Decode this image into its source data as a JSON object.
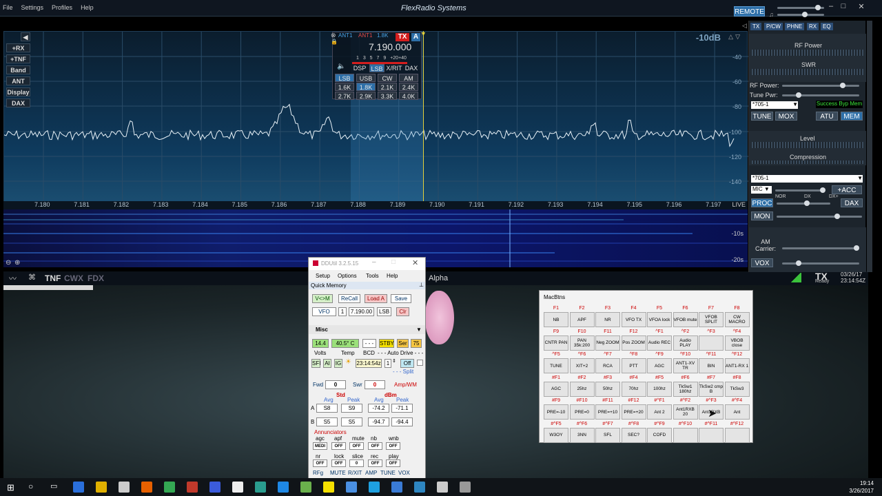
{
  "window": {
    "brand": "FlexRadio Systems",
    "remote": "REMOTE",
    "menu": [
      "File",
      "Settings",
      "Profiles",
      "Help"
    ]
  },
  "pan": {
    "db": "-10dB",
    "ylabels": [
      "-40",
      "-60",
      "-80",
      "-100",
      "-120",
      "-140"
    ],
    "wf_labels": [
      "-10s",
      "-20s"
    ],
    "live": "LIVE",
    "freqs": [
      "7.180",
      "7.181",
      "7.182",
      "7.183",
      "7.184",
      "7.185",
      "7.186",
      "7.187",
      "7.188",
      "7.189",
      "7.190",
      "7.191",
      "7.192",
      "7.193",
      "7.194",
      "7.195",
      "7.196",
      "7.197"
    ]
  },
  "left_buttons": [
    "+RX",
    "+TNF",
    "Band",
    "ANT",
    "Display",
    "DAX"
  ],
  "slice": {
    "ant1": "ANT1",
    "ant2": "ANT1",
    "bw": "1.8K",
    "tx": "TX",
    "letter": "A",
    "freq": "7.190.000",
    "scale": "1 3 5 7 9 +20+40",
    "row1": [
      "DSP",
      "LSB",
      "X/RIT",
      "DAX"
    ],
    "modes": [
      "LSB",
      "USB",
      "CW",
      "AM"
    ],
    "filters1": [
      "1.6K",
      "1.8K",
      "2.1K",
      "2.4K"
    ],
    "filters2": [
      "2.7K",
      "2.9K",
      "3.3K",
      "4.0K"
    ]
  },
  "status": {
    "tnf": "TNF",
    "cwx": "CWX",
    "fdx": "FDX",
    "alpha": "Alpha",
    "tx": "TX",
    "ready": "Ready",
    "date": "03/26/17",
    "time": "23:14:54Z"
  },
  "rpanel": {
    "tabs": [
      "TX",
      "P/CW",
      "PHNE",
      "RX",
      "EQ"
    ],
    "rfpower": "RF Power",
    "swr": "SWR",
    "rf_power_lbl": "RF Power:",
    "tune_pwr": "Tune Pwr:",
    "profile": "*705-1",
    "success": "Success Byp Mem",
    "tune": "TUNE",
    "mox": "MOX",
    "atu": "ATU",
    "mem": "MEM",
    "level": "Level",
    "compression": "Compression",
    "profile2": "*705-1",
    "mic": "MIC",
    "acc": "+ACC",
    "nor": "NOR",
    "dx": "DX",
    "dxplus": "DX+",
    "proc": "PROC",
    "dax": "DAX",
    "mon": "MON",
    "am_carrier": "AM Carrier:",
    "vox": "VOX"
  },
  "ddutil": {
    "title": "DDUtil 3.2.5.15",
    "menu": [
      "Setup",
      "Options",
      "Tools",
      "Help"
    ],
    "qm": "Quick Memory",
    "vm": "V<>M",
    "recall": "ReCall",
    "loada": "Load A",
    "save": "Save",
    "vfo": "VFO",
    "vfo_num": "1",
    "freq": "7.190.00",
    "mode": "LSB",
    "clr": "Clr",
    "misc": "Misc",
    "volts": "14.4",
    "temp": "40.5° C",
    "bcd": "- - -",
    "stby": "STBY",
    "ser": "Ser",
    "num75": "75",
    "lbl_volts": "Volts",
    "lbl_temp": "Temp",
    "lbl_bcd": "BCD",
    "auto": "- - - Auto Drive - - -",
    "sfi": "SFI",
    "ai": "AI",
    "ig": "IG",
    "time": "23:14:54z",
    "spin": "1",
    "off": "Off",
    "split": "- - - Split",
    "fwd": "Fwd",
    "fwd_v": "0",
    "swr": "Swr",
    "swr_v": "0",
    "ampwm": "Amp/WM",
    "std": "Std",
    "dbm": "dBm",
    "avg": "Avg",
    "peak": "Peak",
    "avg2": "Avg",
    "peak2": "Peak",
    "a": "A",
    "a_vals": [
      "S8",
      "S9",
      "-74.2",
      "-71.1"
    ],
    "b": "B",
    "b_vals": [
      "S5",
      "S5",
      "-94.7",
      "-94.4"
    ],
    "annun": "Annunciators",
    "ann1_lbl": [
      "agc",
      "apf",
      "mute",
      "nb",
      "wnb"
    ],
    "ann1_val": [
      "MEDI",
      "OFF",
      "OFF",
      "OFF",
      "OFF"
    ],
    "ann2_lbl": [
      "nr",
      "lock",
      "slice",
      "rec",
      "play"
    ],
    "ann2_val": [
      "OFF",
      "OFF",
      "0",
      "OFF",
      "OFF"
    ],
    "ann3_lbl": [
      "RFg",
      "MUTE",
      "R/XIT",
      "AMP",
      "TUNE",
      "VOX"
    ]
  },
  "macbtns": {
    "title": "MacBtns",
    "rows": [
      {
        "keys": [
          "F1",
          "F2",
          "F3",
          "F4",
          "F5",
          "F6",
          "F7",
          "F8"
        ],
        "btns": [
          "NB",
          "APF",
          "NR",
          "VFO TX",
          "VFOA lock",
          "VFOB mute",
          "VFOB SPLIT",
          "CW MACRO"
        ]
      },
      {
        "keys": [
          "F9",
          "F10",
          "F11",
          "F12",
          "^F1",
          "^F2",
          "^F3",
          "^F4"
        ],
        "btns": [
          "CNTR PAN",
          "PAN 35k:200",
          "Neg ZOOM",
          "Pos ZOOM",
          "Audio REC",
          "Audio PLAY",
          "",
          "VBOB close"
        ]
      },
      {
        "keys": [
          "^F5",
          "^F6",
          "^F7",
          "^F8",
          "^F9",
          "^F10",
          "^F11",
          "^F12"
        ],
        "btns": [
          "TUNE",
          "XIT+2",
          "RCA",
          "PTT",
          "AGC",
          "ANT1-XV TR",
          "BIN",
          "ANT1-RX 1"
        ]
      },
      {
        "keys": [
          "#F1",
          "#F2",
          "#F3",
          "#F4",
          "#F5",
          "#F6",
          "#F7",
          "#F8"
        ],
        "btns": [
          "AGC",
          "25hz",
          "50hz",
          "70hz",
          "100hz",
          "TkSw1 180hz",
          "TkSw2 cmp B",
          "TkSw3"
        ]
      },
      {
        "keys": [
          "#F9",
          "#F10",
          "#F11",
          "#F12",
          "#^F1",
          "#^F2",
          "#^F3",
          "#^F4"
        ],
        "btns": [
          "PRE=-10",
          "PRE=0",
          "PRE=+10",
          "PRE=+20",
          "Ant 2",
          "Ant1RXB 20",
          "Ant1RXB",
          "Ant"
        ]
      },
      {
        "keys": [
          "#^F5",
          "#^F6",
          "#^F7",
          "#^F8",
          "#^F9",
          "#^F10",
          "#^F11",
          "#^F12"
        ],
        "btns": [
          "W3OY",
          "3NN",
          "SFL",
          "SEC?",
          "COFD",
          "",
          "",
          ""
        ]
      }
    ]
  },
  "taskbar": {
    "time": "19:14",
    "date": "3/26/2017"
  }
}
